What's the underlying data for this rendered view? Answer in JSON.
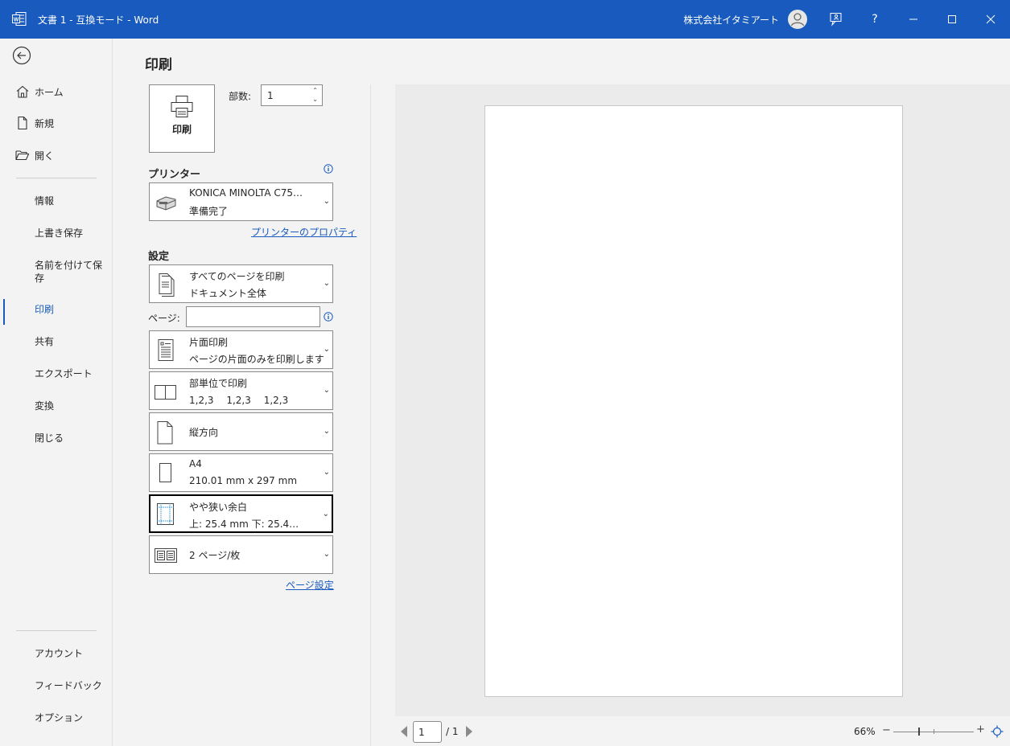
{
  "titlebar": {
    "title": "文書 1  -  互換モード  -  Word",
    "user": "株式会社イタミアート",
    "buttons": [
      "feedback-icon",
      "help",
      "minimize",
      "maximize",
      "close"
    ],
    "help_label": "?"
  },
  "nav": {
    "back_icon": "back-arrow-icon",
    "top_items": [
      {
        "label": "ホーム",
        "icon": "home-icon"
      },
      {
        "label": "新規",
        "icon": "new-doc-icon"
      },
      {
        "label": "開く",
        "icon": "folder-open-icon"
      }
    ],
    "mid_items": [
      {
        "label": "情報"
      },
      {
        "label": "上書き保存"
      },
      {
        "label": "名前を付けて保存"
      },
      {
        "label": "印刷",
        "active": true
      },
      {
        "label": "共有"
      },
      {
        "label": "エクスポート"
      },
      {
        "label": "変換"
      },
      {
        "label": "閉じる"
      }
    ],
    "bottom_items": [
      {
        "label": "アカウント"
      },
      {
        "label": "フィードバック"
      },
      {
        "label": "オプション"
      }
    ]
  },
  "main": {
    "title": "印刷",
    "print_button": "印刷",
    "copies_label": "部数:",
    "copies_value": "1",
    "printer_section": "プリンター",
    "printer": {
      "name": "KONICA MINOLTA C75…",
      "status": "準備完了"
    },
    "printer_properties_link": "プリンターのプロパティ",
    "settings_section": "設定",
    "settings": [
      {
        "line1": "すべてのページを印刷",
        "line2": "ドキュメント全体",
        "icon": "pages-icon"
      },
      {
        "line1": "片面印刷",
        "line2": "ページの片面のみを印刷します",
        "icon": "one-sided-icon"
      },
      {
        "line1": "部単位で印刷",
        "line2": "1,2,3　 1,2,3　 1,2,3",
        "icon": "collate-icon"
      },
      {
        "line1": "縦方向",
        "line2": "",
        "icon": "portrait-icon"
      },
      {
        "line1": "A4",
        "line2": "210.01 mm x 297 mm",
        "icon": "paper-size-icon"
      },
      {
        "line1": "やや狭い余白",
        "line2": "上: 25.4 mm 下: 25.4…",
        "icon": "margins-icon"
      },
      {
        "line1": "2 ページ/枚",
        "line2": "",
        "icon": "pages-per-sheet-icon"
      }
    ],
    "pages_label": "ページ:",
    "pages_value": "",
    "page_setup_link": "ページ設定"
  },
  "preview": {
    "current_page": "1",
    "total_pages": "/ 1",
    "zoom": "66%",
    "zoom_minus": "−",
    "zoom_plus": "+"
  },
  "colors": {
    "accent": "#185abd",
    "titlebar": "#185abd",
    "background": "#f3f3f3"
  }
}
